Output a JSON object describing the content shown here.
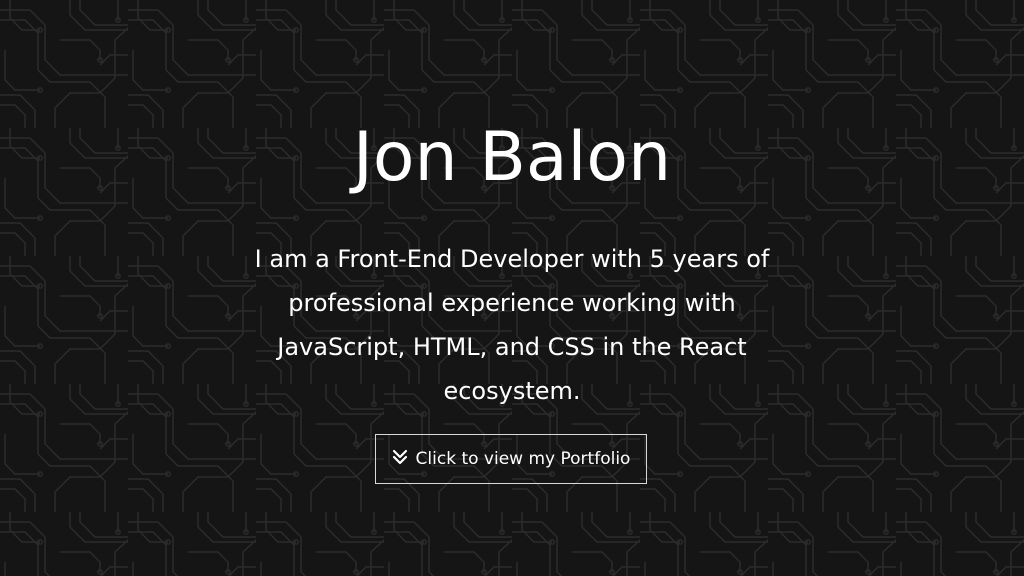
{
  "hero": {
    "name": "Jon Balon",
    "bio": "I am a Front-End Developer with 5 years of professional experience working with JavaScript, HTML, and CSS in the React ecosystem.",
    "cta_label": "Click to view my Portfolio",
    "cta_icon": "double-chevron-down-icon"
  },
  "colors": {
    "background": "#151515",
    "pattern_line": "#2e2e2e",
    "text": "#ffffff",
    "button_border": "#d8d8d8"
  }
}
